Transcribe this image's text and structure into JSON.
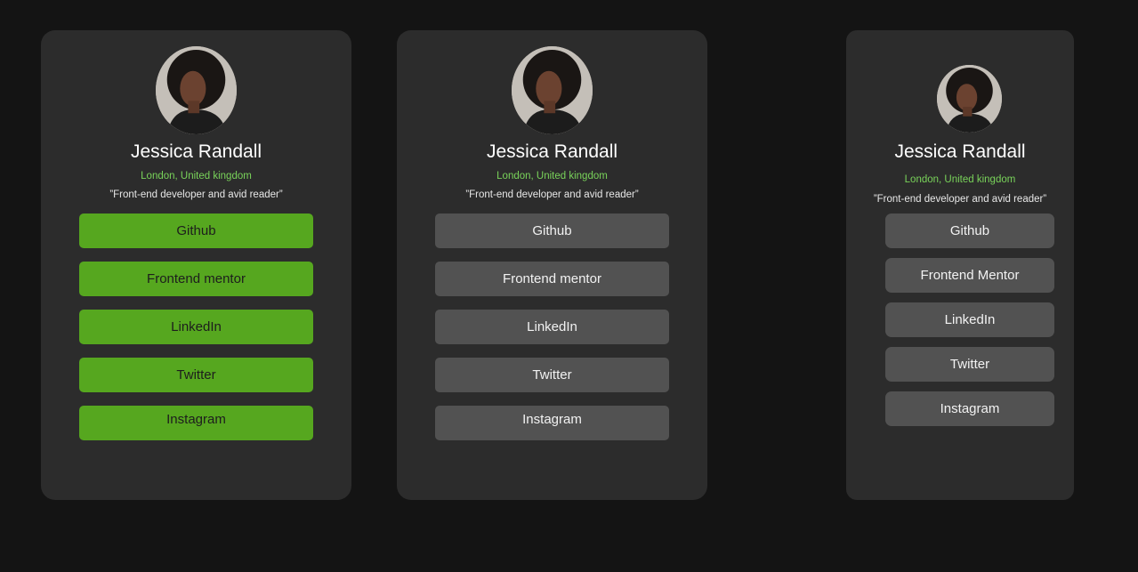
{
  "colors": {
    "page_background": "#141414",
    "card_background": "#2c2c2c",
    "accent_green": "#56a71f",
    "location_green": "#79d35a",
    "button_gray": "#525252"
  },
  "cards": [
    {
      "avatar_icon": "profile-photo",
      "name": "Jessica Randall",
      "location": "London, United kingdom",
      "bio": "”Front-end developer and avid reader”",
      "links": [
        "Github",
        "Frontend mentor",
        "LinkedIn",
        "Twitter",
        "Instagram"
      ]
    },
    {
      "avatar_icon": "profile-photo",
      "name": "Jessica Randall",
      "location": "London, United kingdom",
      "bio": "”Front-end developer and avid reader”",
      "links": [
        "Github",
        "Frontend mentor",
        "LinkedIn",
        "Twitter",
        "Instagram"
      ]
    },
    {
      "avatar_icon": "profile-photo",
      "name": "Jessica Randall",
      "location": "London, United kingdom",
      "bio": "”Front-end developer and avid reader”",
      "links": [
        "Github",
        "Frontend Mentor",
        "LinkedIn",
        "Twitter",
        "Instagram"
      ]
    }
  ]
}
